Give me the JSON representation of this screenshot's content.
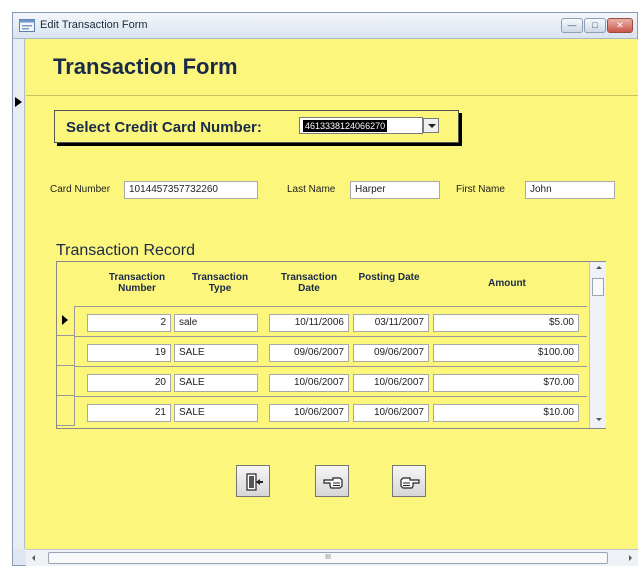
{
  "window": {
    "title": "Edit Transaction Form",
    "icon": "form-icon",
    "buttons": [
      "minimize-icon",
      "maximize-icon",
      "close-icon"
    ]
  },
  "form": {
    "title": "Transaction Form",
    "select_label": "Select Credit Card Number:",
    "selected_card": "4613338124066270"
  },
  "fields": {
    "card_number": {
      "label": "Card Number",
      "value": "1014457357732260"
    },
    "last_name": {
      "label": "Last Name",
      "value": "Harper"
    },
    "first_name": {
      "label": "First Name",
      "value": "John"
    }
  },
  "records": {
    "title": "Transaction Record",
    "headers": {
      "number": "Transaction Number",
      "type": "Transaction Type",
      "date": "Transaction Date",
      "posting": "Posting Date",
      "amount": "Amount"
    },
    "rows": [
      {
        "number": "2",
        "type": "sale",
        "date": "10/11/2006",
        "posting": "03/11/2007",
        "amount": "$5.00"
      },
      {
        "number": "19",
        "type": "SALE",
        "date": "09/06/2007",
        "posting": "09/06/2007",
        "amount": "$100.00"
      },
      {
        "number": "20",
        "type": "SALE",
        "date": "10/06/2007",
        "posting": "10/06/2007",
        "amount": "$70.00"
      },
      {
        "number": "21",
        "type": "SALE",
        "date": "10/06/2007",
        "posting": "10/06/2007",
        "amount": "$10.00"
      }
    ]
  },
  "nav_buttons": [
    "exit-door-icon",
    "point-left-icon",
    "point-right-icon"
  ],
  "colors": {
    "form_background": "#fcf67c",
    "title_text": "#1a2a4a"
  },
  "scrollbar": {
    "grip": "III"
  }
}
